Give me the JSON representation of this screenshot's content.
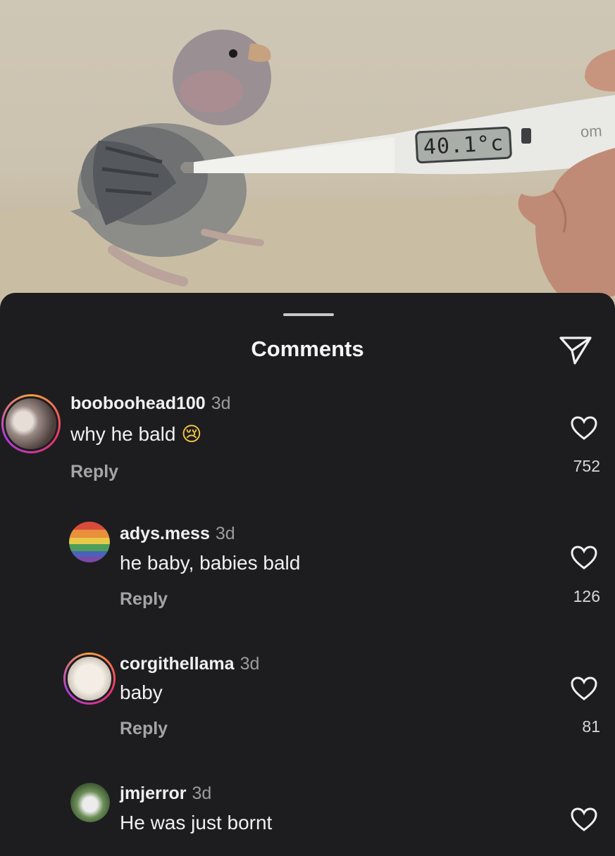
{
  "video": {
    "thermometer_reading": "40.1°c",
    "thermometer_brand": "om"
  },
  "sheet": {
    "title": "Comments"
  },
  "comments": [
    {
      "username": "booboohead100",
      "age": "3d",
      "text": "why he bald",
      "emoji": "😢",
      "reply_label": "Reply",
      "likes": "752",
      "avatar_ring": true
    },
    {
      "username": "adys.mess",
      "age": "3d",
      "text": "he baby, babies bald",
      "reply_label": "Reply",
      "likes": "126",
      "avatar_ring": false
    },
    {
      "username": "corgithellama",
      "age": "3d",
      "text": "baby",
      "reply_label": "Reply",
      "likes": "81",
      "avatar_ring": true
    },
    {
      "username": "jmjerror",
      "age": "3d",
      "text": "He was just bornt",
      "avatar_ring": false
    }
  ],
  "colors": {
    "background": "#1d1d20",
    "text_primary": "#f0f0f0",
    "text_secondary": "#9b9b9b",
    "story_ring": [
      "#f9a23b",
      "#e8336d",
      "#b23bd8"
    ]
  },
  "icons": {
    "share": "paper-plane-icon",
    "like": "heart-outline-icon"
  }
}
